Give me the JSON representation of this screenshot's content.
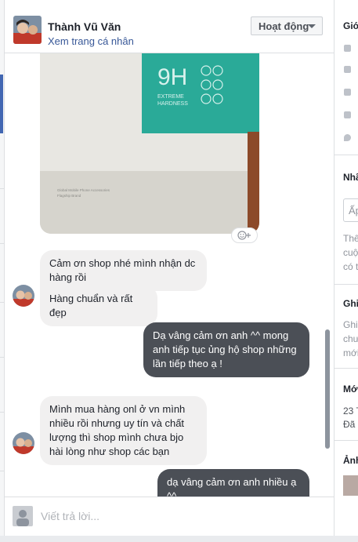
{
  "header": {
    "name": "Thành Vũ Văn",
    "profile_link": "Xem trang cá nhân",
    "status_button": "Hoạt động"
  },
  "photo": {
    "badge_big": "9H",
    "badge_line1": "EXTREME",
    "badge_line2": "HARDNESS",
    "box_text1": "Global Mobile Phone Accessories",
    "box_text2": "Flagship Brand"
  },
  "messages": [
    {
      "from": "them",
      "text": "Cảm ơn shop nhé mình nhận dc hàng rồi"
    },
    {
      "from": "them",
      "text": "Hàng chuẩn và rất đẹp"
    },
    {
      "from": "me",
      "text": "Dạ vâng cảm ơn anh ^^ mong anh tiếp tục ủng hộ shop những lần tiếp theo ạ !"
    },
    {
      "from": "them",
      "text": "Mình mua hàng onl ở vn mình nhiều rồi nhưng uy tín và chất lượng thì shop mình chưa bjo hài lòng như shop các bạn"
    },
    {
      "from": "me",
      "text": "dạ vâng cảm ơn anh nhiều ạ ^^"
    }
  ],
  "composer": {
    "placeholder": "Viết trả lời..."
  },
  "right_panel": {
    "about_title": "Giớ",
    "notes_title": "Nhã",
    "notes_field": "Ấp",
    "notes_text": [
      "Thê",
      "cuộ",
      "có t"
    ],
    "notes2_title": "Ghi",
    "notes2_text": [
      "Ghi",
      "chư",
      "mới"
    ],
    "recent_title": "Mới",
    "recent_date": "23 T",
    "recent_text": "Đã",
    "images_title": "Ảnh"
  },
  "colors": {
    "link": "#385898",
    "outgoing_bubble": "#4b4f56",
    "incoming_bubble": "#f1f0f0",
    "accent": "#4267b2"
  }
}
